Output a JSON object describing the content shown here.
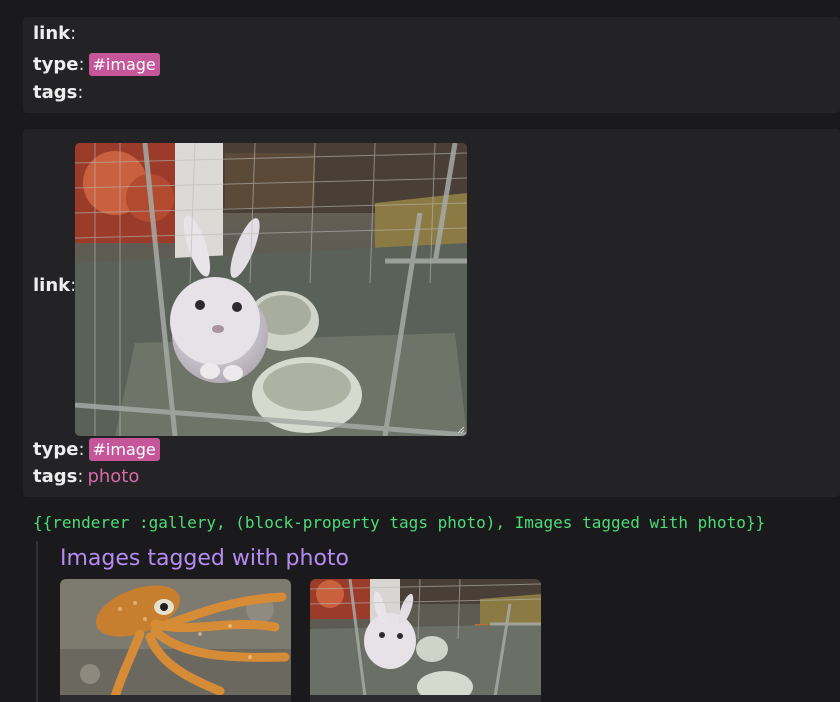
{
  "blocks": [
    {
      "link_key": "link",
      "type_key": "type",
      "type_value": "#image",
      "tags_key": "tags",
      "tags_value": ""
    },
    {
      "link_key": "link",
      "type_key": "type",
      "type_value": "#image",
      "tags_key": "tags",
      "tags_value": "photo"
    }
  ],
  "gallery": {
    "macro": "{{renderer :gallery, (block-property tags photo), Images tagged with photo}}",
    "title": "Images tagged with photo"
  },
  "colors": {
    "background": "#1a1a1c",
    "block_background": "#232325",
    "tag_pill": "#c5569a",
    "tag_link": "#d86aa7",
    "macro_text": "#4edc77",
    "gallery_title": "#b58cf3"
  },
  "icons": [
    "resize-grip-icon"
  ]
}
